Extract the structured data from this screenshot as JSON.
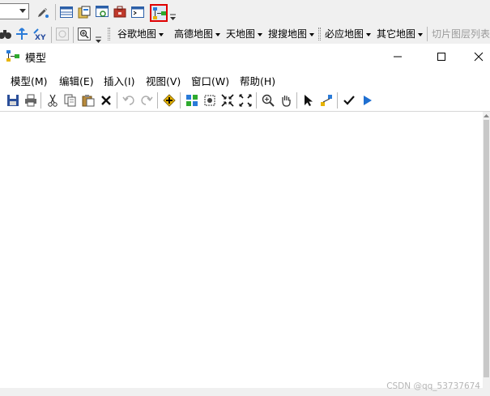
{
  "toolbar_top": {
    "icons": [
      "edit-pencil-icon",
      "attribute-table-icon",
      "catalog-icon",
      "search-window-icon",
      "toolbox-icon",
      "python-window-icon",
      "model-builder-icon"
    ]
  },
  "map_toolbar": {
    "menus": [
      "谷歌地图",
      "高德地图",
      "天地图",
      "搜搜地图",
      "必应地图",
      "其它地图"
    ],
    "tail_label": "切片图层列表"
  },
  "window": {
    "title": "模型",
    "controls": {
      "minimize": "–",
      "maximize": "☐",
      "close": "✕"
    }
  },
  "menubar": {
    "items": [
      "模型(M)",
      "编辑(E)",
      "插入(I)",
      "视图(V)",
      "窗口(W)",
      "帮助(H)"
    ]
  },
  "colors": {
    "highlight_border": "#e00000",
    "accent_blue": "#1f6fd1"
  },
  "watermark": "CSDN @qq_53737674"
}
